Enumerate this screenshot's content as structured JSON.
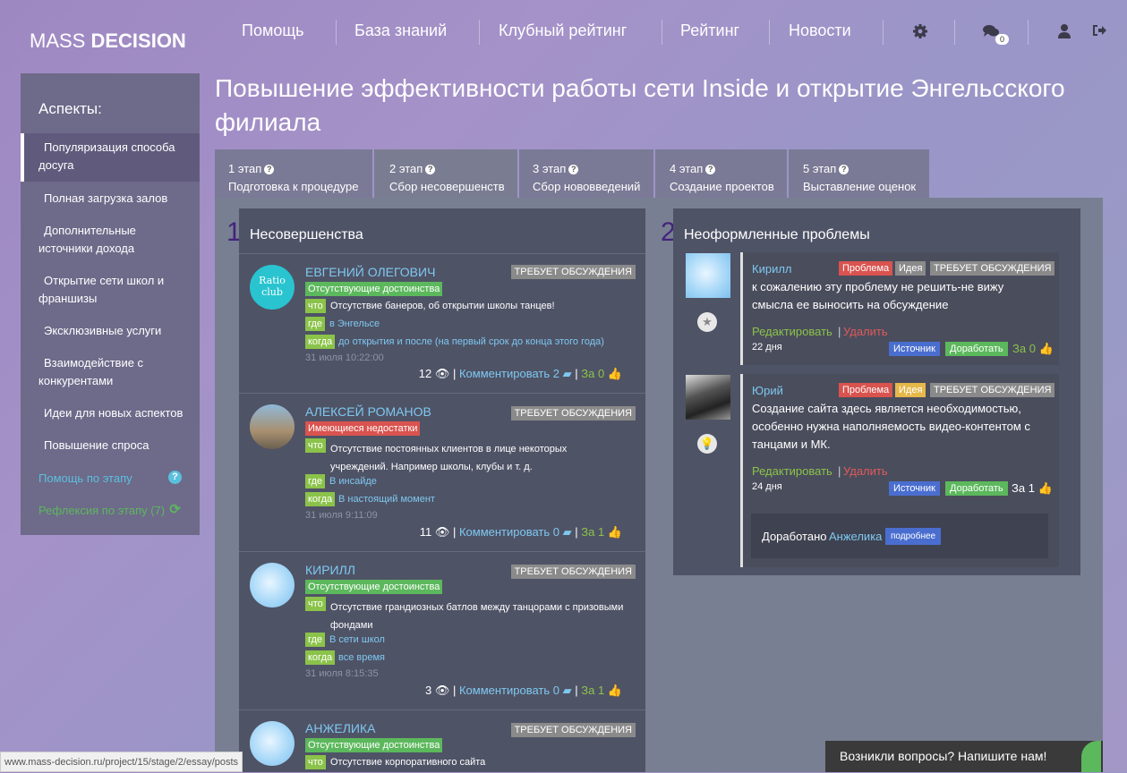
{
  "header": {
    "logo_light": "MASS ",
    "logo_bold": "DECISION",
    "nav": [
      "Помощь",
      "База знаний",
      "Клубный рейтинг",
      "Рейтинг",
      "Новости"
    ],
    "chat_count": "0",
    "icons": [
      "gear-icon",
      "chat-icon",
      "user-icon",
      "logout-icon"
    ]
  },
  "sidebar": {
    "title": "Аспекты:",
    "items": [
      "Популяризация способа досуга",
      "Полная загрузка залов",
      "Дополнительные источники дохода",
      "Открытие сети школ и франшизы",
      "Эксклюзивные услуги",
      "Взаимодействие с конкурентами",
      "Идеи для новых аспектов",
      "Повышение спроса"
    ],
    "help": "Помощь по этапу",
    "reflection": "Рефлексия по этапу (7)"
  },
  "page": {
    "title": "Повышение эффективности работы сети Inside и открытие Энгельсского филиала"
  },
  "tabs": [
    {
      "step": "1 этап",
      "label": "Подготовка к процедуре"
    },
    {
      "step": "2 этап",
      "label": "Сбор несовершенств"
    },
    {
      "step": "3 этап",
      "label": "Сбор нововведений"
    },
    {
      "step": "4 этап",
      "label": "Создание проектов"
    },
    {
      "step": "5 этап",
      "label": "Выставление оценок"
    }
  ],
  "col1": {
    "number": "1",
    "title": "Несовершенства",
    "cards": [
      {
        "user": "ЕВГЕНИЙ ОЛЕГОВИЧ",
        "status": "ТРЕБУЕТ ОБСУЖДЕНИЯ",
        "type": "Отсутствующие достоинства",
        "what_label": "что",
        "what": "Отсутствие банеров, об открытии школы танцев!",
        "where_label": "где",
        "where": "в Энгельсе",
        "when_label": "когда",
        "when": "до открытия и после (на первый срок до конца этого года)",
        "date": "31 июля 10:22:00",
        "views": "12",
        "comment": "Комментировать 2",
        "za": "За 0",
        "avatar_text": "Ratio club"
      },
      {
        "user": "АЛЕКСЕЙ РОМАНОВ",
        "status": "ТРЕБУЕТ ОБСУЖДЕНИЯ",
        "type": "Имеющиеся недостатки",
        "what_label": "что",
        "what": "Отсутствие постоянных клиентов в лице некоторых учреждений. Например школы, клубы и т. д.",
        "where_label": "где",
        "where": "В инсайде",
        "when_label": "когда",
        "when": "В настоящий момент",
        "date": "31 июля 9:11:09",
        "views": "11",
        "comment": "Комментировать 0",
        "za": "За 1"
      },
      {
        "user": "КИРИЛЛ",
        "status": "ТРЕБУЕТ ОБСУЖДЕНИЯ",
        "type": "Отсутствующие достоинства",
        "what_label": "что",
        "what": "Отсутствие грандиозных батлов между танцорами с призовыми фондами",
        "where_label": "где",
        "where": "В сети школ",
        "when_label": "когда",
        "when": "все время",
        "date": "31 июля 8:15:35",
        "views": "3",
        "comment": "Комментировать 0",
        "za": "За 1"
      },
      {
        "user": "АНЖЕЛИКА",
        "status": "ТРЕБУЕТ ОБСУЖДЕНИЯ",
        "type": "Отсутствующие достоинства",
        "what_label": "что",
        "what": "Отсутствие корпоративного сайта"
      }
    ]
  },
  "col2": {
    "number": "2",
    "title": "Неоформленные проблемы",
    "cards": [
      {
        "user": "Кирилл",
        "tag_problem": "Проблема",
        "tag_idea": "Идея",
        "status": "ТРЕБУЕТ ОБСУЖДЕНИЯ",
        "text": "к сожалению эту проблему не решить-не вижу смысла ее выносить на обсуждение",
        "edit": "Редактировать",
        "sep": "|",
        "delete": "Удалить",
        "days": "22 дня",
        "source": "Источник",
        "improve": "Доработать",
        "za": "За 0"
      },
      {
        "user": "Юрий",
        "tag_problem": "Проблема",
        "tag_idea": "Идея",
        "status": "ТРЕБУЕТ ОБСУЖДЕНИЯ",
        "text": "Создание сайта здесь является необходимостью, особенно нужна наполняемость видео-контентом с танцами и МК.",
        "edit": "Редактировать",
        "sep": "|",
        "delete": "Удалить",
        "days": "24 дня",
        "source": "Источник",
        "improve": "Доработать",
        "za": "За 1",
        "improved_prefix": "Доработано",
        "improved_by": "Анжелика",
        "more": "подробнее"
      }
    ]
  },
  "footer": {
    "url": "www.mass-decision.ru/project/15/stage/2/essay/posts",
    "chat_prompt": "Возникли вопросы? Напишите нам!"
  },
  "colors": {
    "accent_blue": "#7ec8f0",
    "green": "#5cb85c",
    "red": "#d9534f",
    "panel": "#4f5366"
  }
}
